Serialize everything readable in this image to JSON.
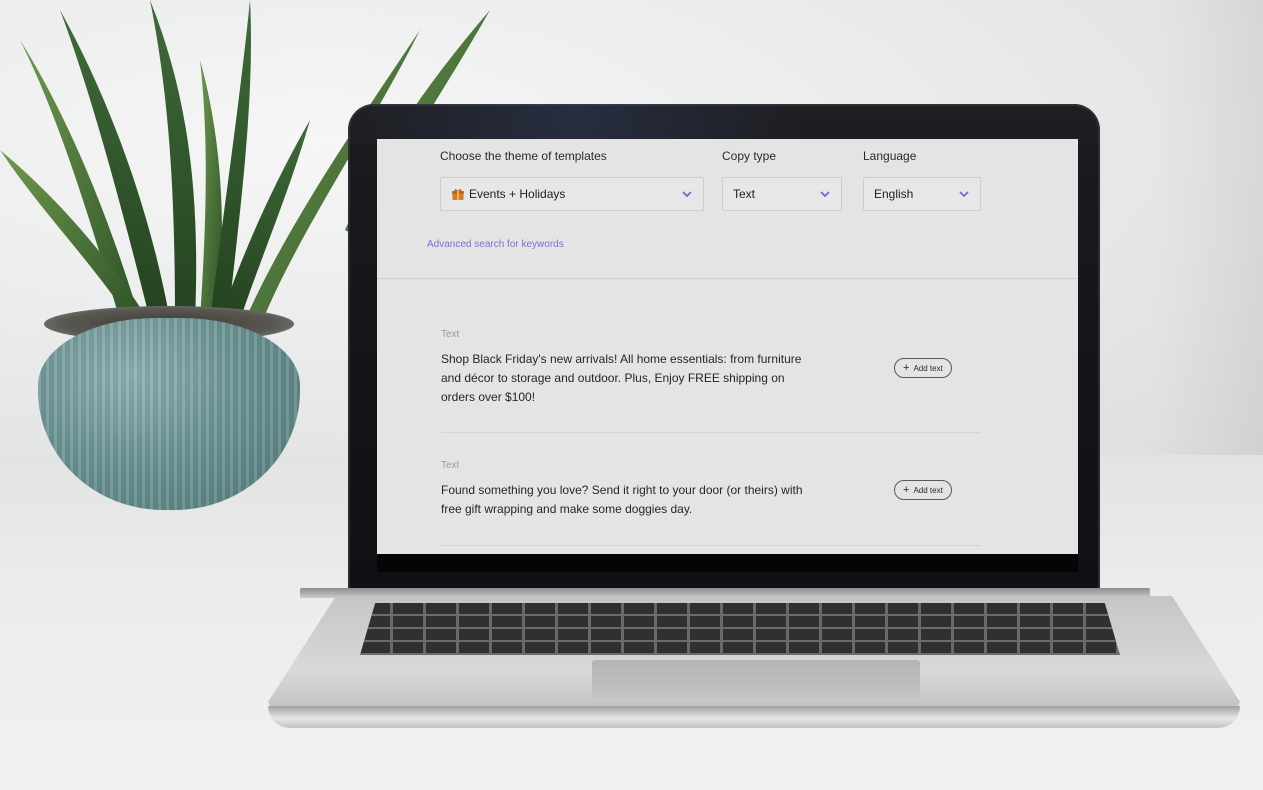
{
  "filters": {
    "theme": {
      "label": "Choose the theme of templates",
      "value": "Events + Holidays"
    },
    "copy_type": {
      "label": "Copy type",
      "value": "Text"
    },
    "language": {
      "label": "Language",
      "value": "English"
    },
    "advanced_link": "Advanced search for keywords"
  },
  "results": [
    {
      "type": "Text",
      "text": "Shop Black Friday's new arrivals! All home essentials: from furniture and décor to storage and outdoor. Plus, Enjoy FREE shipping on orders over $100!",
      "button": "Add text"
    },
    {
      "type": "Text",
      "text": "Found something you love? Send it right to your door (or theirs) with free gift wrapping and make some doggies day.",
      "button": "Add text"
    }
  ],
  "colors": {
    "link": "#7a72c9",
    "chevron": "#6b63c7",
    "gift_icon": "#d9772b"
  },
  "icons": {
    "theme_icon": "gift-icon",
    "chevron": "chevron-down-icon",
    "add": "plus-icon"
  }
}
